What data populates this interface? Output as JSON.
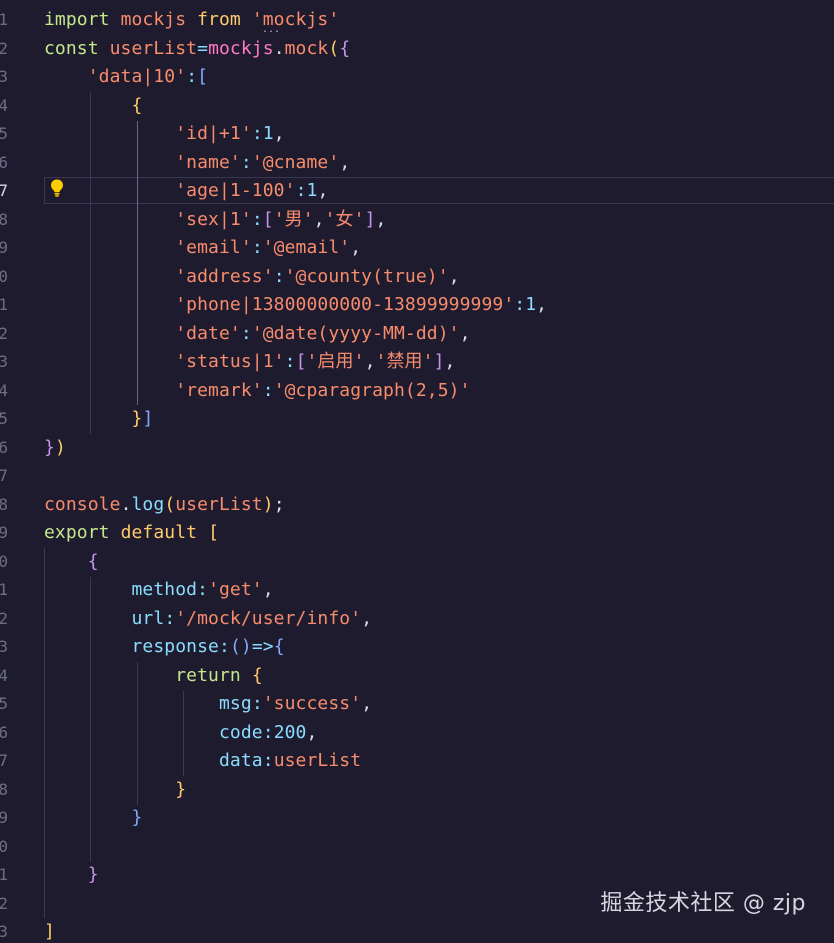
{
  "editor": {
    "line_numbers": [
      "1",
      "2",
      "3",
      "4",
      "5",
      "6",
      "7",
      "8",
      "9",
      "0",
      "1",
      "2",
      "3",
      "4",
      "5",
      "6",
      "7",
      "8",
      "9",
      "0",
      "1",
      "2",
      "3",
      "4",
      "5",
      "6",
      "7",
      "8",
      "9",
      "0",
      "1",
      "2",
      "3"
    ],
    "active_line_index": 6,
    "lines": [
      [
        {
          "t": "import ",
          "c": "green"
        },
        {
          "t": "mockjs ",
          "c": "orange"
        },
        {
          "t": "from ",
          "c": "yellow"
        },
        {
          "t": "'mockjs'",
          "c": "orange"
        }
      ],
      [
        {
          "t": "const ",
          "c": "green"
        },
        {
          "t": "userList",
          "c": "orange"
        },
        {
          "t": "=",
          "c": "cyan"
        },
        {
          "t": "mockjs",
          "c": "pink"
        },
        {
          "t": ".",
          "c": "white"
        },
        {
          "t": "mock",
          "c": "orange"
        },
        {
          "t": "(",
          "c": "yellow"
        },
        {
          "t": "{",
          "c": "purple"
        }
      ],
      [
        {
          "t": "    'data|10'",
          "c": "orange"
        },
        {
          "t": ":",
          "c": "cyan"
        },
        {
          "t": "[",
          "c": "blue"
        }
      ],
      [
        {
          "t": "        {",
          "c": "yellow"
        }
      ],
      [
        {
          "t": "            'id|+1'",
          "c": "orange"
        },
        {
          "t": ":",
          "c": "cyan"
        },
        {
          "t": "1",
          "c": "cyan"
        },
        {
          "t": ",",
          "c": "white"
        }
      ],
      [
        {
          "t": "            'name'",
          "c": "orange"
        },
        {
          "t": ":",
          "c": "cyan"
        },
        {
          "t": "'@cname'",
          "c": "orange"
        },
        {
          "t": ",",
          "c": "white"
        }
      ],
      [
        {
          "t": "            'age|1-100'",
          "c": "orange"
        },
        {
          "t": ":",
          "c": "cyan"
        },
        {
          "t": "1",
          "c": "cyan"
        },
        {
          "t": ",",
          "c": "white"
        }
      ],
      [
        {
          "t": "            'sex|1'",
          "c": "orange"
        },
        {
          "t": ":",
          "c": "cyan"
        },
        {
          "t": "[",
          "c": "purple"
        },
        {
          "t": "'男'",
          "c": "orange"
        },
        {
          "t": ",",
          "c": "white"
        },
        {
          "t": "'女'",
          "c": "orange"
        },
        {
          "t": "]",
          "c": "purple"
        },
        {
          "t": ",",
          "c": "white"
        }
      ],
      [
        {
          "t": "            'email'",
          "c": "orange"
        },
        {
          "t": ":",
          "c": "cyan"
        },
        {
          "t": "'@email'",
          "c": "orange"
        },
        {
          "t": ",",
          "c": "white"
        }
      ],
      [
        {
          "t": "            'address'",
          "c": "orange"
        },
        {
          "t": ":",
          "c": "cyan"
        },
        {
          "t": "'@county(true)'",
          "c": "orange"
        },
        {
          "t": ",",
          "c": "white"
        }
      ],
      [
        {
          "t": "            'phone|13800000000-13899999999'",
          "c": "orange"
        },
        {
          "t": ":",
          "c": "cyan"
        },
        {
          "t": "1",
          "c": "cyan"
        },
        {
          "t": ",",
          "c": "white"
        }
      ],
      [
        {
          "t": "            'date'",
          "c": "orange"
        },
        {
          "t": ":",
          "c": "cyan"
        },
        {
          "t": "'@date(yyyy-MM-dd)'",
          "c": "orange"
        },
        {
          "t": ",",
          "c": "white"
        }
      ],
      [
        {
          "t": "            'status|1'",
          "c": "orange"
        },
        {
          "t": ":",
          "c": "cyan"
        },
        {
          "t": "[",
          "c": "purple"
        },
        {
          "t": "'启用'",
          "c": "orange"
        },
        {
          "t": ",",
          "c": "white"
        },
        {
          "t": "'禁用'",
          "c": "orange"
        },
        {
          "t": "]",
          "c": "purple"
        },
        {
          "t": ",",
          "c": "white"
        }
      ],
      [
        {
          "t": "            'remark'",
          "c": "orange"
        },
        {
          "t": ":",
          "c": "cyan"
        },
        {
          "t": "'@cparagraph(2,5)'",
          "c": "orange"
        }
      ],
      [
        {
          "t": "        }",
          "c": "yellow"
        },
        {
          "t": "]",
          "c": "blue"
        }
      ],
      [
        {
          "t": "}",
          "c": "purple"
        },
        {
          "t": ")",
          "c": "yellow"
        }
      ],
      [],
      [
        {
          "t": "console",
          "c": "orange"
        },
        {
          "t": ".",
          "c": "white"
        },
        {
          "t": "log",
          "c": "cyan"
        },
        {
          "t": "(",
          "c": "yellow"
        },
        {
          "t": "userList",
          "c": "orange"
        },
        {
          "t": ")",
          "c": "yellow"
        },
        {
          "t": ";",
          "c": "white"
        }
      ],
      [
        {
          "t": "export ",
          "c": "green"
        },
        {
          "t": "default ",
          "c": "yellow"
        },
        {
          "t": "[",
          "c": "yellow"
        }
      ],
      [
        {
          "t": "    {",
          "c": "purple"
        }
      ],
      [
        {
          "t": "        method",
          "c": "cyan"
        },
        {
          "t": ":",
          "c": "cyan"
        },
        {
          "t": "'get'",
          "c": "orange"
        },
        {
          "t": ",",
          "c": "white"
        }
      ],
      [
        {
          "t": "        url",
          "c": "cyan"
        },
        {
          "t": ":",
          "c": "cyan"
        },
        {
          "t": "'/mock/user/info'",
          "c": "orange"
        },
        {
          "t": ",",
          "c": "white"
        }
      ],
      [
        {
          "t": "        response",
          "c": "cyan"
        },
        {
          "t": ":",
          "c": "cyan"
        },
        {
          "t": "()",
          "c": "blue"
        },
        {
          "t": "=>",
          "c": "cyan"
        },
        {
          "t": "{",
          "c": "blue"
        }
      ],
      [
        {
          "t": "            return ",
          "c": "green"
        },
        {
          "t": "{",
          "c": "yellow"
        }
      ],
      [
        {
          "t": "                msg",
          "c": "cyan"
        },
        {
          "t": ":",
          "c": "cyan"
        },
        {
          "t": "'success'",
          "c": "orange"
        },
        {
          "t": ",",
          "c": "white"
        }
      ],
      [
        {
          "t": "                code",
          "c": "cyan"
        },
        {
          "t": ":",
          "c": "cyan"
        },
        {
          "t": "200",
          "c": "cyan"
        },
        {
          "t": ",",
          "c": "white"
        }
      ],
      [
        {
          "t": "                data",
          "c": "cyan"
        },
        {
          "t": ":",
          "c": "cyan"
        },
        {
          "t": "userList",
          "c": "orange"
        }
      ],
      [
        {
          "t": "            }",
          "c": "yellow"
        }
      ],
      [
        {
          "t": "        }",
          "c": "blue"
        }
      ],
      [],
      [
        {
          "t": "    }",
          "c": "purple"
        }
      ],
      [],
      [
        {
          "t": "]",
          "c": "yellow"
        }
      ]
    ]
  },
  "lightbulb": {
    "icon": "lightbulb-icon",
    "color": "#ffcc00"
  },
  "watermark": {
    "text": "掘金技术社区 @ zjp"
  }
}
